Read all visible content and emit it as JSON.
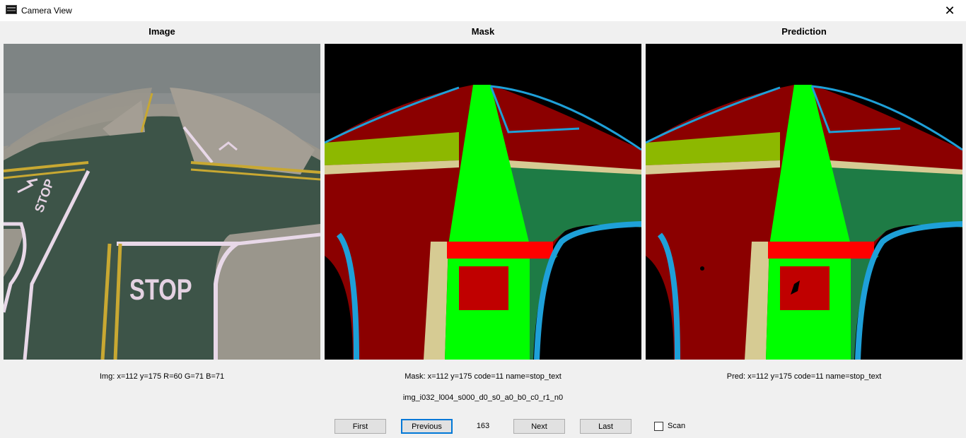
{
  "window": {
    "title": "Camera View"
  },
  "panels": {
    "image": {
      "title": "Image",
      "info": "Img: x=112  y=175  R=60 G=71  B=71",
      "sign_text": "STOP",
      "left_text": "STOP"
    },
    "mask": {
      "title": "Mask",
      "info": "Mask: x=112  y=175  code=11  name=stop_text"
    },
    "prediction": {
      "title": "Prediction",
      "info": "Pred: x=112  y=175  code=11  name=stop_text"
    }
  },
  "filename": "img_i032_l004_s000_d0_s0_a0_b0_c0_r1_n0",
  "navigation": {
    "first": "First",
    "previous": "Previous",
    "counter": "163",
    "next": "Next",
    "last": "Last",
    "scan_label": "Scan",
    "scan_checked": false
  },
  "colors": {
    "background": "#000000",
    "road_dark_red": "#8b0000",
    "lane_green": "#00ff00",
    "dark_green": "#1e7b45",
    "yellow_green": "#8db800",
    "beige": "#d6cb93",
    "cyan_border": "#1ea0d8",
    "stop_line_red": "#ff0000",
    "stop_text_red": "#c00000",
    "photo_road": "#3d5448",
    "photo_wall": "#8a8e8e",
    "photo_line_white": "#e8d8e8",
    "photo_line_yellow": "#c8a832"
  }
}
